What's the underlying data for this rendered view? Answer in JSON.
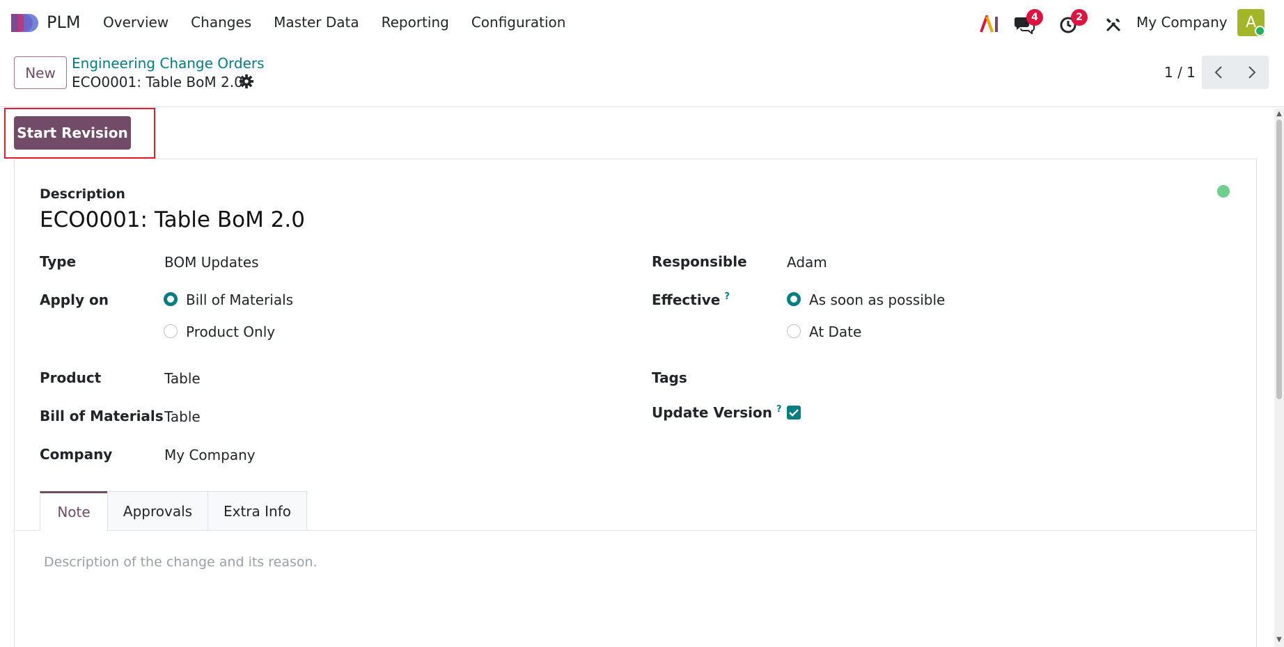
{
  "navbar": {
    "app_name": "PLM",
    "menu": [
      "Overview",
      "Changes",
      "Master Data",
      "Reporting",
      "Configuration"
    ],
    "ai_label": "AI",
    "messages_count": "4",
    "activities_count": "2",
    "company": "My Company",
    "avatar_initial": "A"
  },
  "control_panel": {
    "new_label": "New",
    "breadcrumb_parent": "Engineering Change Orders",
    "breadcrumb_current": "ECO0001: Table BoM 2.0",
    "pager": "1 / 1"
  },
  "statusbar": {
    "start_revision_label": "Start Revision"
  },
  "form": {
    "description_label": "Description",
    "title": "ECO0001: Table BoM 2.0",
    "type_label": "Type",
    "type_value": "BOM Updates",
    "apply_on_label": "Apply on",
    "apply_on_options": [
      "Bill of Materials",
      "Product Only"
    ],
    "apply_on_selected": "Bill of Materials",
    "product_label": "Product",
    "product_value": "Table",
    "bom_label": "Bill of Materials",
    "bom_value": "Table",
    "company_label": "Company",
    "company_value": "My Company",
    "responsible_label": "Responsible",
    "responsible_value": "Adam",
    "effective_label": "Effective",
    "effective_options": [
      "As soon as possible",
      "At Date"
    ],
    "effective_selected": "As soon as possible",
    "tags_label": "Tags",
    "update_version_label": "Update Version",
    "update_version_checked": true,
    "help_mark": "?"
  },
  "tabs": [
    "Note",
    "Approvals",
    "Extra Info"
  ],
  "active_tab": "Note",
  "note_placeholder": "Description of the change and its reason.",
  "colors": {
    "primary": "#714b67",
    "accent": "#017e84",
    "badge": "#e0123f",
    "status_dot": "#6fcf8c"
  }
}
